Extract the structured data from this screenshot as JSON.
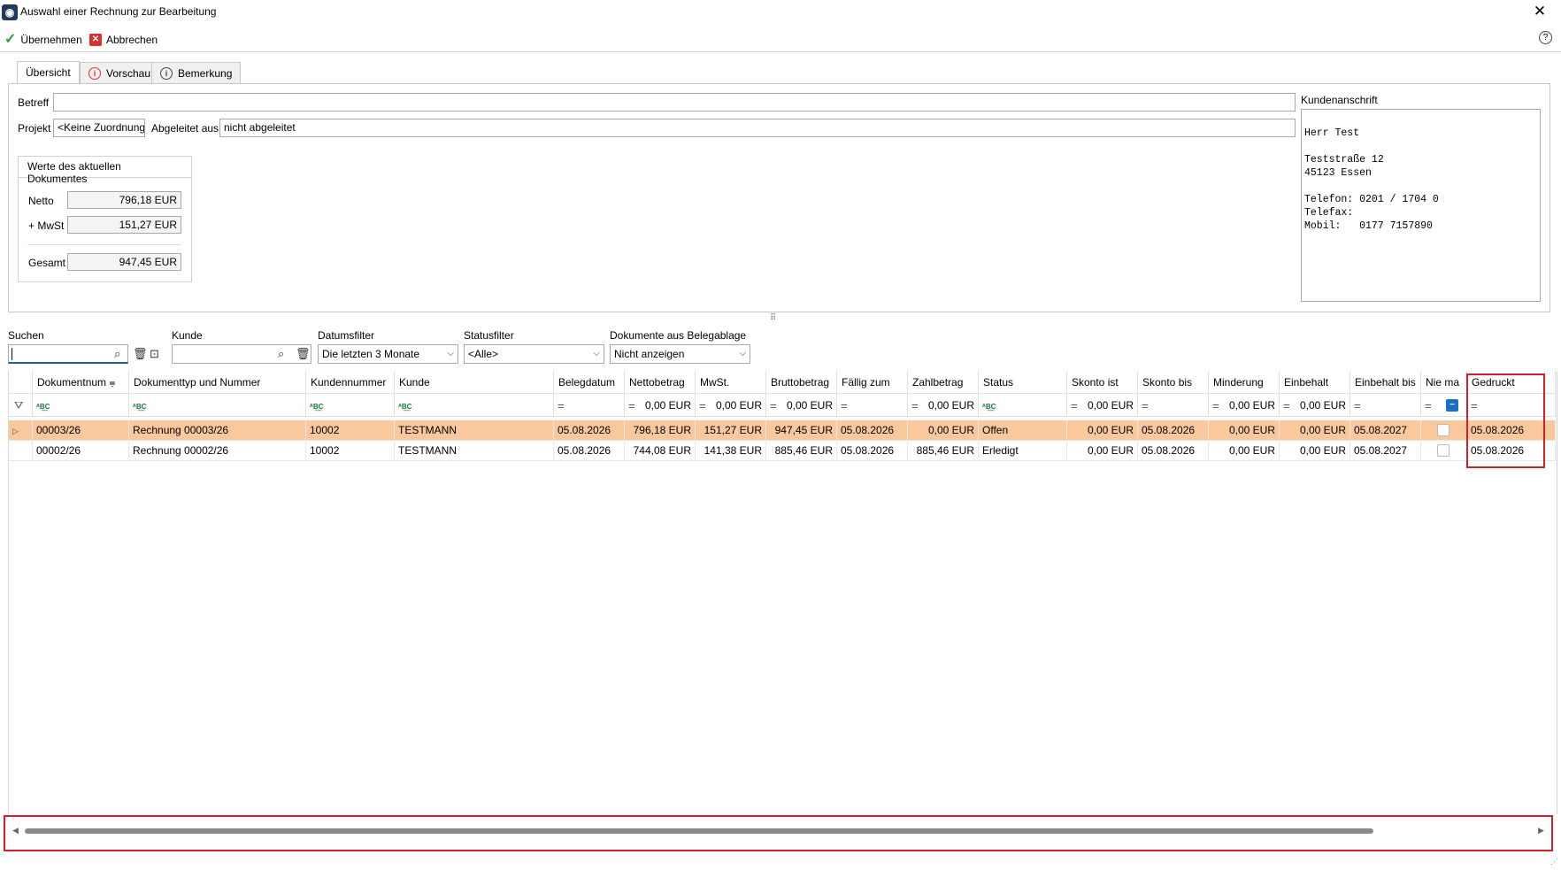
{
  "window": {
    "title": "Auswahl einer Rechnung zur Bearbeitung",
    "close_symbol": "✕"
  },
  "toolbar": {
    "apply_label": "Übernehmen",
    "cancel_label": "Abbrechen"
  },
  "tabs": [
    {
      "label": "Übersicht",
      "active": true
    },
    {
      "label": "Vorschau",
      "icon": "warning-icon"
    },
    {
      "label": "Bemerkung",
      "icon": "info-icon"
    }
  ],
  "form": {
    "betreff_label": "Betreff",
    "betreff_value": "",
    "projekt_label": "Projekt",
    "projekt_value": "<Keine Zuordnung",
    "derived_label": "Abgeleitet aus",
    "derived_value": "nicht abgeleitet"
  },
  "values": {
    "title": "Werte des aktuellen Dokumentes",
    "netto_label": "Netto",
    "netto": "796,18 EUR",
    "mwst_label": "+ MwSt",
    "mwst": "151,27 EUR",
    "gesamt_label": "Gesamt",
    "gesamt": "947,45 EUR"
  },
  "address": {
    "label": "Kundenanschrift",
    "text": "Herr Test\n\nTeststraße 12\n45123 Essen\n\nTelefon: 0201 / 1704 0\nTelefax:\nMobil:   0177 7157890"
  },
  "filters": {
    "search_label": "Suchen",
    "search_value": "",
    "customer_label": "Kunde",
    "customer_value": "",
    "date_label": "Datumsfilter",
    "date_value": "Die letzten 3 Monate",
    "status_label": "Statusfilter",
    "status_value": "<Alle>",
    "docs_label": "Dokumente aus Belegablage",
    "docs_value": "Nicht anzeigen"
  },
  "grid": {
    "headers": [
      "Dokumentnum",
      "Dokumenttyp und Nummer",
      "Kundennummer",
      "Kunde",
      "Belegdatum",
      "Nettobetrag",
      "MwSt.",
      "Bruttobetrag",
      "Fällig zum",
      "Zahlbetrag",
      "Status",
      "Skonto ist",
      "Skonto bis",
      "Minderung",
      "Einbehalt",
      "Einbehalt bis",
      "Nie ma",
      "Gedruckt"
    ],
    "filter_amount": "0,00 EUR",
    "rows": [
      {
        "docnum": "00003/26",
        "doctype": "Rechnung 00003/26",
        "custnum": "10002",
        "customer": "TESTMANN",
        "date": "05.08.2026",
        "net": "796,18 EUR",
        "vat": "151,27 EUR",
        "gross": "947,45 EUR",
        "due": "05.08.2026",
        "pay": "0,00 EUR",
        "status": "Offen",
        "skonto": "0,00 EUR",
        "skonto_until": "05.08.2026",
        "reduction": "0,00 EUR",
        "retention": "0,00 EUR",
        "retention_until": "05.08.2027",
        "never": false,
        "printed": "05.08.2026"
      },
      {
        "docnum": "00002/26",
        "doctype": "Rechnung 00002/26",
        "custnum": "10002",
        "customer": "TESTMANN",
        "date": "05.08.2026",
        "net": "744,08 EUR",
        "vat": "141,38 EUR",
        "gross": "885,46 EUR",
        "due": "05.08.2026",
        "pay": "885,46 EUR",
        "status": "Erledigt",
        "skonto": "0,00 EUR",
        "skonto_until": "05.08.2026",
        "reduction": "0,00 EUR",
        "retention": "0,00 EUR",
        "retention_until": "05.08.2027",
        "never": false,
        "printed": "05.08.2026"
      }
    ]
  },
  "colors": {
    "selected_row": "#f9c89d",
    "highlight": "#d21f2b",
    "accent": "#1a6fc4"
  }
}
